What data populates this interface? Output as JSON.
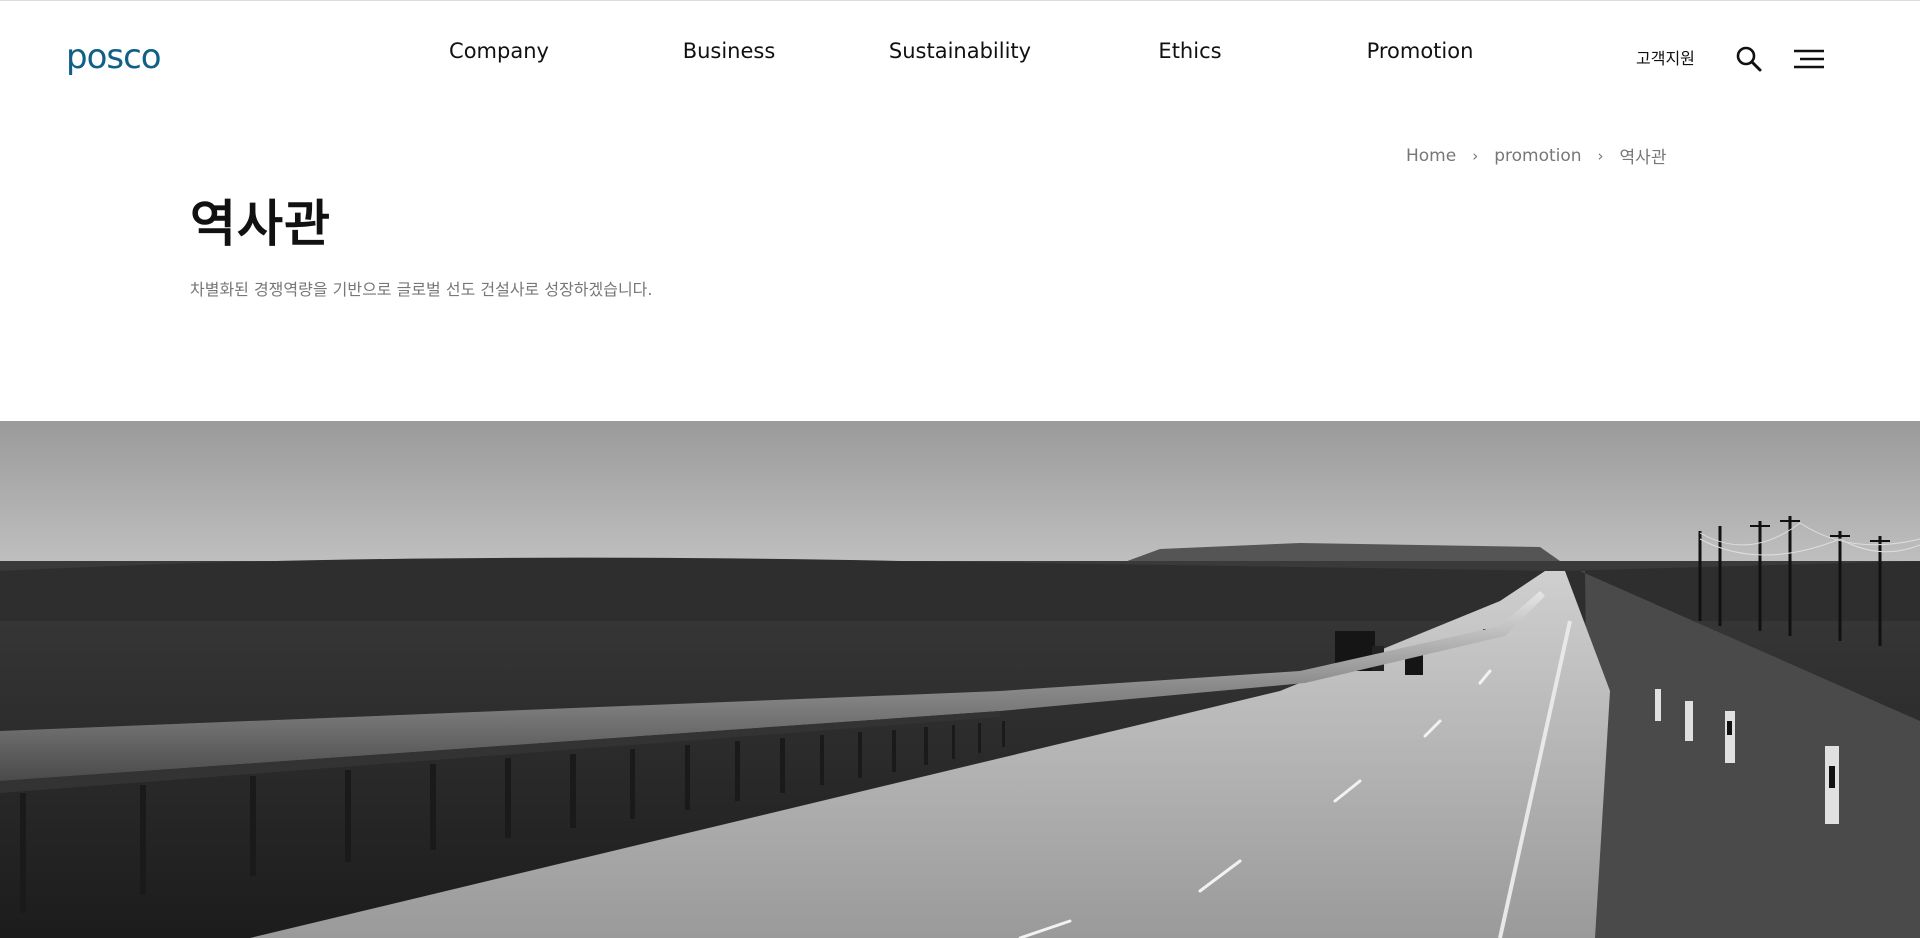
{
  "header": {
    "logo": "posco",
    "nav": [
      "Company",
      "Business",
      "Sustainability",
      "Ethics",
      "Promotion"
    ],
    "support_label": "고객지원"
  },
  "breadcrumb": {
    "home": "Home",
    "section": "promotion",
    "current": "역사관"
  },
  "page": {
    "title": "역사관",
    "subtitle": "차별화된 경쟁역량을 기반으로 글로벌 선도 건설사로 성장하겠습니다."
  },
  "colors": {
    "brand": "#0f5f86",
    "text": "#111111",
    "muted": "#777777"
  },
  "icons": [
    "search-icon",
    "hamburger-menu-icon"
  ]
}
